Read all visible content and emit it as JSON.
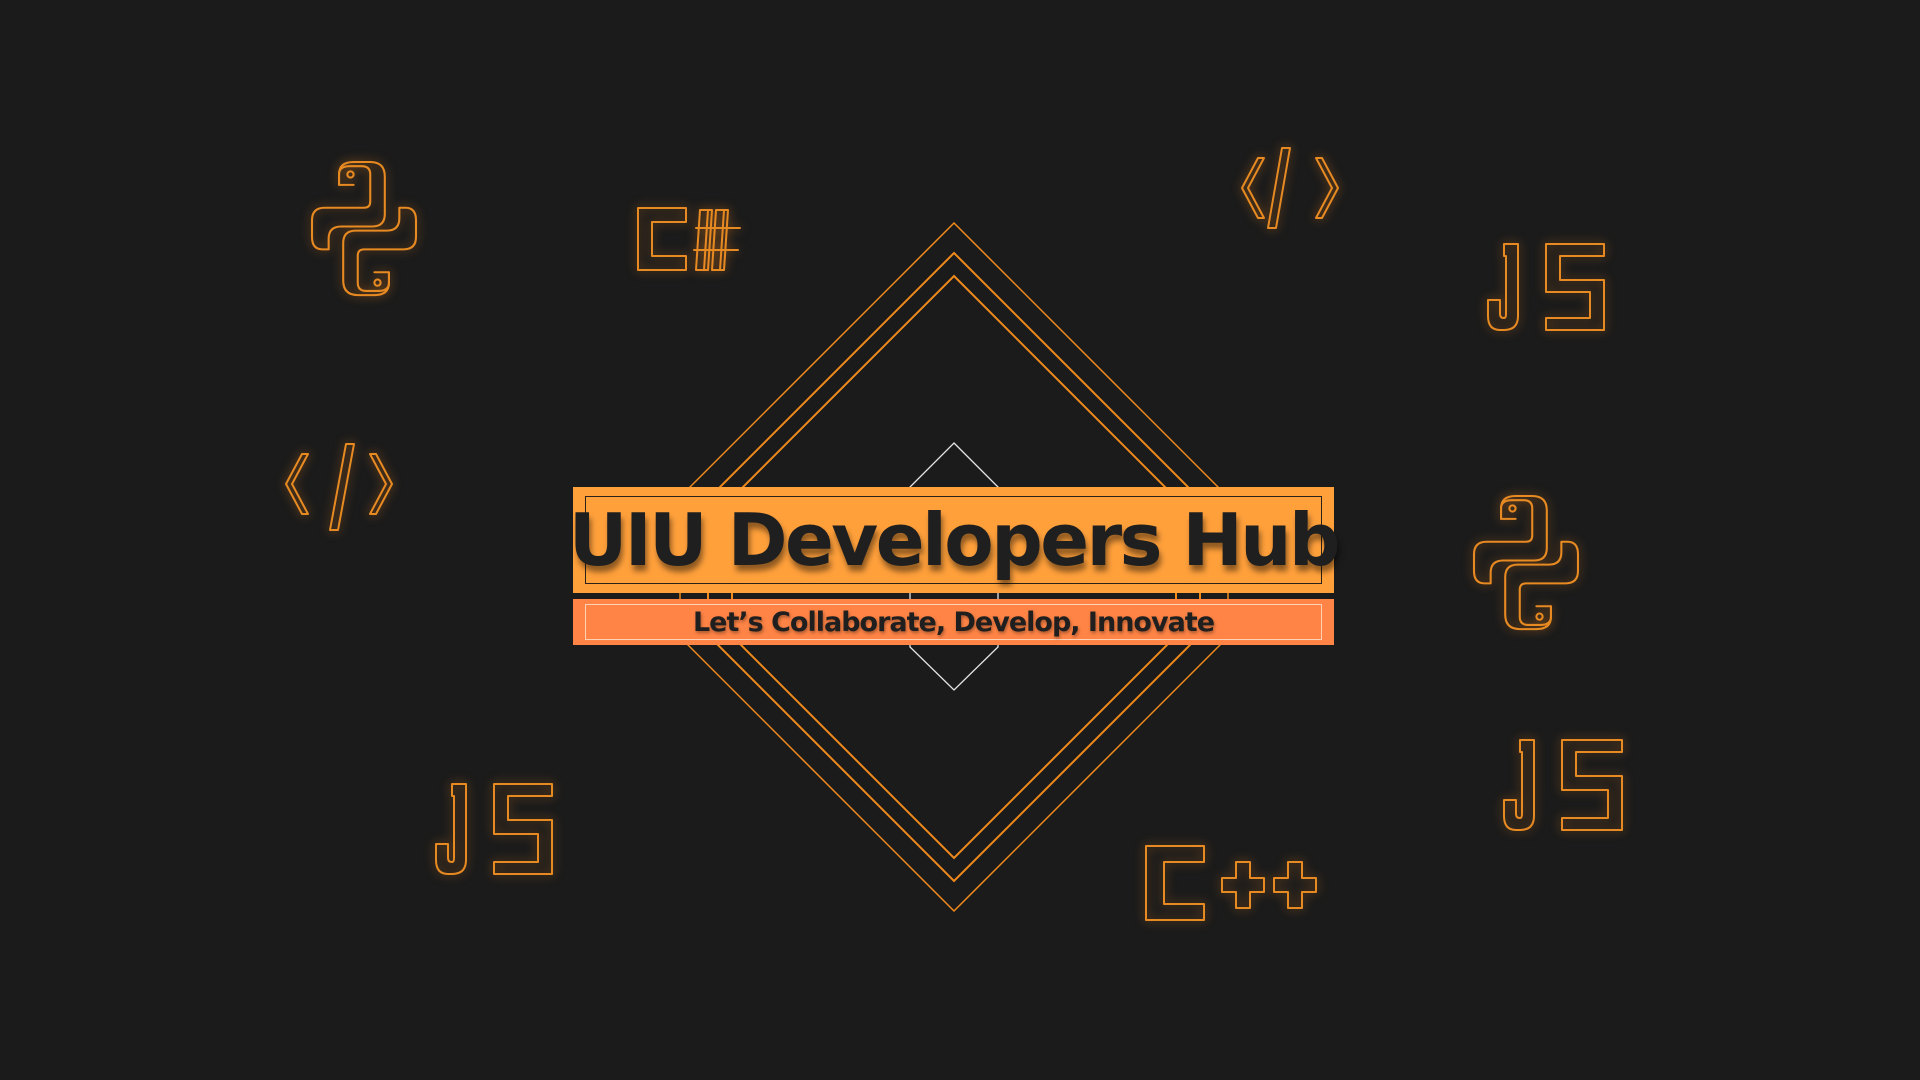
{
  "banner": {
    "title": "UIU Developers Hub",
    "subtitle": "Let’s Collaborate, Develop, Innovate"
  },
  "background_icons": [
    {
      "name": "python-icon"
    },
    {
      "name": "csharp-icon",
      "text": "C#"
    },
    {
      "name": "code-tag-icon"
    },
    {
      "name": "javascript-icon",
      "text": "JS"
    },
    {
      "name": "code-tag-icon"
    },
    {
      "name": "python-icon"
    },
    {
      "name": "javascript-icon",
      "text": "JS"
    },
    {
      "name": "javascript-icon",
      "text": "JS"
    },
    {
      "name": "cplusplus-icon",
      "text": "C++"
    }
  ],
  "colors": {
    "background": "#1b1b1b",
    "accent_orange": "#ffa03b",
    "subtitle_orange": "#ff8446",
    "outline_orange": "#f08a1c",
    "text_dark": "#1f1f1f",
    "diamond_white": "#e6e6e6"
  }
}
